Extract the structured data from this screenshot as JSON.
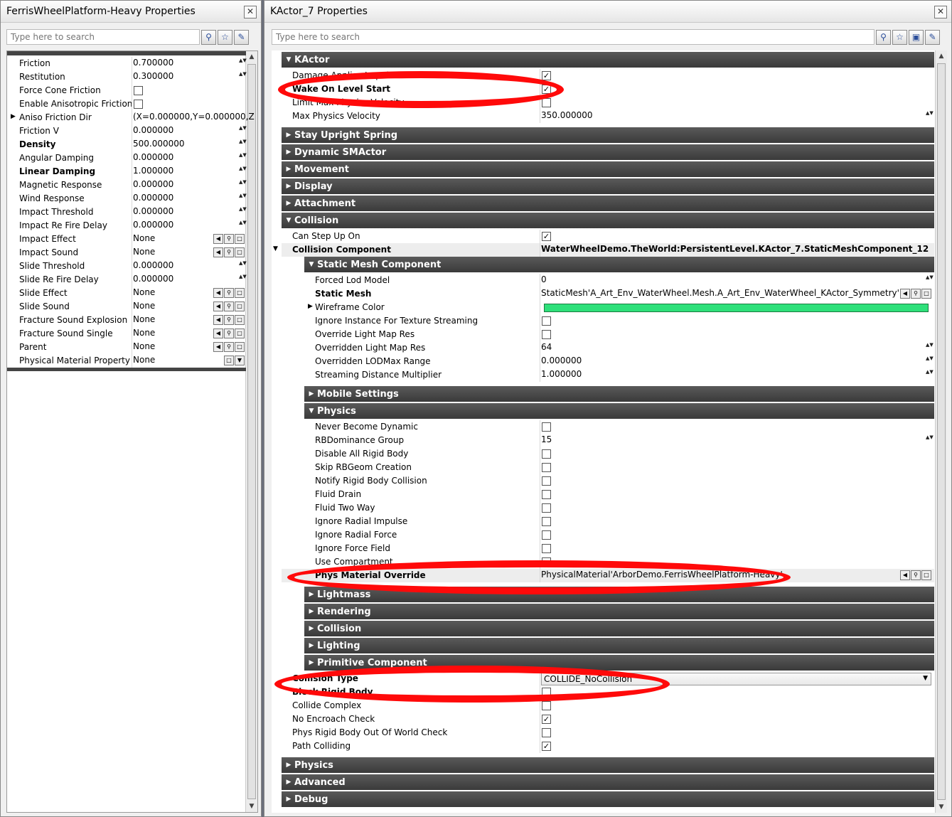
{
  "left_window": {
    "title": "FerrisWheelPlatform-Heavy Properties",
    "search_placeholder": "Type here to search",
    "rows": [
      {
        "name": "Friction",
        "value": "0.700000",
        "bold": false,
        "ctrl": "spin"
      },
      {
        "name": "Restitution",
        "value": "0.300000",
        "bold": false,
        "ctrl": "spin"
      },
      {
        "name": "Force Cone Friction",
        "value": "",
        "bold": false,
        "ctrl": "check",
        "checked": false
      },
      {
        "name": "Enable Anisotropic Friction",
        "value": "",
        "bold": false,
        "ctrl": "check",
        "checked": false
      },
      {
        "name": "Aniso Friction Dir",
        "value": "(X=0.000000,Y=0.000000,Z",
        "bold": false,
        "ctrl": "none",
        "expander": true
      },
      {
        "name": "Friction V",
        "value": "0.000000",
        "bold": false,
        "ctrl": "spin"
      },
      {
        "name": "Density",
        "value": "500.000000",
        "bold": true,
        "ctrl": "spin"
      },
      {
        "name": "Angular Damping",
        "value": "0.000000",
        "bold": false,
        "ctrl": "spin"
      },
      {
        "name": "Linear Damping",
        "value": "1.000000",
        "bold": true,
        "ctrl": "spin"
      },
      {
        "name": "Magnetic Response",
        "value": "0.000000",
        "bold": false,
        "ctrl": "spin"
      },
      {
        "name": "Wind Response",
        "value": "0.000000",
        "bold": false,
        "ctrl": "spin"
      },
      {
        "name": "Impact Threshold",
        "value": "0.000000",
        "bold": false,
        "ctrl": "spin"
      },
      {
        "name": "Impact Re Fire Delay",
        "value": "0.000000",
        "bold": false,
        "ctrl": "spin"
      },
      {
        "name": "Impact Effect",
        "value": "None",
        "bold": false,
        "ctrl": "obj"
      },
      {
        "name": "Impact Sound",
        "value": "None",
        "bold": false,
        "ctrl": "obj"
      },
      {
        "name": "Slide Threshold",
        "value": "0.000000",
        "bold": false,
        "ctrl": "spin"
      },
      {
        "name": "Slide Re Fire Delay",
        "value": "0.000000",
        "bold": false,
        "ctrl": "spin"
      },
      {
        "name": "Slide Effect",
        "value": "None",
        "bold": false,
        "ctrl": "obj"
      },
      {
        "name": "Slide Sound",
        "value": "None",
        "bold": false,
        "ctrl": "obj"
      },
      {
        "name": "Fracture Sound Explosion",
        "value": "None",
        "bold": false,
        "ctrl": "obj"
      },
      {
        "name": "Fracture Sound Single",
        "value": "None",
        "bold": false,
        "ctrl": "obj"
      },
      {
        "name": "Parent",
        "value": "None",
        "bold": false,
        "ctrl": "obj"
      },
      {
        "name": "Physical Material Property",
        "value": "None",
        "bold": false,
        "ctrl": "obj2"
      }
    ]
  },
  "right_window": {
    "title": "KActor_7 Properties",
    "search_placeholder": "Type here to search",
    "items": [
      {
        "kind": "cat",
        "label": "KActor",
        "open": true,
        "indent": 0
      },
      {
        "kind": "row",
        "name": "Damage Applies Impulse",
        "indent": 0,
        "ctrl": "check",
        "checked": true
      },
      {
        "kind": "row",
        "name": "Wake On Level Start",
        "bold": true,
        "indent": 0,
        "ctrl": "check",
        "checked": true
      },
      {
        "kind": "row",
        "name": "Limit Max Physics Velocity",
        "indent": 0,
        "ctrl": "check",
        "checked": false
      },
      {
        "kind": "row",
        "name": "Max Physics Velocity",
        "value": "350.000000",
        "indent": 0,
        "ctrl": "spin"
      },
      {
        "kind": "gap"
      },
      {
        "kind": "cat",
        "label": "Stay Upright Spring",
        "open": false,
        "indent": 0
      },
      {
        "kind": "cat",
        "label": "Dynamic SMActor",
        "open": false,
        "indent": 0
      },
      {
        "kind": "cat",
        "label": "Movement",
        "open": false,
        "indent": 0
      },
      {
        "kind": "cat",
        "label": "Display",
        "open": false,
        "indent": 0
      },
      {
        "kind": "cat",
        "label": "Attachment",
        "open": false,
        "indent": 0
      },
      {
        "kind": "cat",
        "label": "Collision",
        "open": true,
        "indent": 0
      },
      {
        "kind": "row",
        "name": "Can Step Up On",
        "indent": 0,
        "ctrl": "check",
        "checked": true
      },
      {
        "kind": "row",
        "name": "Collision Component",
        "value": "WaterWheelDemo.TheWorld:PersistentLevel.KActor_7.StaticMeshComponent_12",
        "bold": true,
        "valbold": true,
        "indent": 0,
        "expander": "open",
        "shade": true
      },
      {
        "kind": "cat",
        "label": "Static Mesh Component",
        "open": true,
        "indent": 1
      },
      {
        "kind": "row",
        "name": "Forced Lod Model",
        "value": "0",
        "indent": 1,
        "ctrl": "spin"
      },
      {
        "kind": "row",
        "name": "Static Mesh",
        "value": "StaticMesh'A_Art_Env_WaterWheel.Mesh.A_Art_Env_WaterWheel_KActor_Symmetry'",
        "bold": true,
        "indent": 1,
        "ctrl": "obj"
      },
      {
        "kind": "row",
        "name": "Wireframe Color",
        "value": "",
        "indent": 1,
        "ctrl": "color",
        "expander": "closed"
      },
      {
        "kind": "row",
        "name": "Ignore Instance For Texture Streaming",
        "indent": 1,
        "ctrl": "check",
        "checked": false
      },
      {
        "kind": "row",
        "name": "Override Light Map Res",
        "indent": 1,
        "ctrl": "check",
        "checked": false
      },
      {
        "kind": "row",
        "name": "Overridden Light Map Res",
        "value": "64",
        "indent": 1,
        "ctrl": "spin"
      },
      {
        "kind": "row",
        "name": "Overridden LODMax Range",
        "value": "0.000000",
        "indent": 1,
        "ctrl": "spin"
      },
      {
        "kind": "row",
        "name": "Streaming Distance Multiplier",
        "value": "1.000000",
        "indent": 1,
        "ctrl": "spin"
      },
      {
        "kind": "gap"
      },
      {
        "kind": "cat",
        "label": "Mobile Settings",
        "open": false,
        "indent": 1
      },
      {
        "kind": "cat",
        "label": "Physics",
        "open": true,
        "indent": 1
      },
      {
        "kind": "row",
        "name": "Never Become Dynamic",
        "indent": 1,
        "ctrl": "check",
        "checked": false
      },
      {
        "kind": "row",
        "name": "RBDominance Group",
        "value": "15",
        "indent": 1,
        "ctrl": "spin"
      },
      {
        "kind": "row",
        "name": "Disable All Rigid Body",
        "indent": 1,
        "ctrl": "check",
        "checked": false
      },
      {
        "kind": "row",
        "name": "Skip RBGeom Creation",
        "indent": 1,
        "ctrl": "check",
        "checked": false
      },
      {
        "kind": "row",
        "name": "Notify Rigid Body Collision",
        "indent": 1,
        "ctrl": "check",
        "checked": false
      },
      {
        "kind": "row",
        "name": "Fluid Drain",
        "indent": 1,
        "ctrl": "check",
        "checked": false
      },
      {
        "kind": "row",
        "name": "Fluid Two Way",
        "indent": 1,
        "ctrl": "check",
        "checked": false
      },
      {
        "kind": "row",
        "name": "Ignore Radial Impulse",
        "indent": 1,
        "ctrl": "check",
        "checked": false
      },
      {
        "kind": "row",
        "name": "Ignore Radial Force",
        "indent": 1,
        "ctrl": "check",
        "checked": false
      },
      {
        "kind": "row",
        "name": "Ignore Force Field",
        "indent": 1,
        "ctrl": "check",
        "checked": false
      },
      {
        "kind": "row",
        "name": "Use Compartment",
        "indent": 1,
        "ctrl": "check",
        "checked": false
      },
      {
        "kind": "row",
        "name": "Phys Material Override",
        "value": "PhysicalMaterial'ArborDemo.FerrisWheelPlatform-Heavy'",
        "bold": true,
        "indent": 1,
        "ctrl": "obj",
        "shade": true
      },
      {
        "kind": "gap"
      },
      {
        "kind": "cat",
        "label": "Lightmass",
        "open": false,
        "indent": 1
      },
      {
        "kind": "cat",
        "label": "Rendering",
        "open": false,
        "indent": 1
      },
      {
        "kind": "cat",
        "label": "Collision",
        "open": false,
        "indent": 1
      },
      {
        "kind": "cat",
        "label": "Lighting",
        "open": false,
        "indent": 1
      },
      {
        "kind": "cat",
        "label": "Primitive Component",
        "open": false,
        "indent": 1
      },
      {
        "kind": "row",
        "name": "Collision Type",
        "value": "COLLIDE_NoCollision",
        "bold": true,
        "indent": 0,
        "ctrl": "combo"
      },
      {
        "kind": "row",
        "name": "Block Rigid Body",
        "bold": true,
        "indent": 0,
        "ctrl": "check",
        "checked": false
      },
      {
        "kind": "row",
        "name": "Collide Complex",
        "indent": 0,
        "ctrl": "check",
        "checked": false
      },
      {
        "kind": "row",
        "name": "No Encroach Check",
        "indent": 0,
        "ctrl": "check",
        "checked": true
      },
      {
        "kind": "row",
        "name": "Phys Rigid Body Out Of World Check",
        "indent": 0,
        "ctrl": "check",
        "checked": false
      },
      {
        "kind": "row",
        "name": "Path Colliding",
        "indent": 0,
        "ctrl": "check",
        "checked": true
      },
      {
        "kind": "gap"
      },
      {
        "kind": "cat",
        "label": "Physics",
        "open": false,
        "indent": 0
      },
      {
        "kind": "cat",
        "label": "Advanced",
        "open": false,
        "indent": 0
      },
      {
        "kind": "cat",
        "label": "Debug",
        "open": false,
        "indent": 0
      }
    ]
  },
  "colors": {
    "annotation_red": "#ff0a0a",
    "wireframe_color": "#2ee07a",
    "category_bar": "#404040"
  },
  "icons": [
    "close-icon",
    "search-icon",
    "favorites-star-icon",
    "wrench-icon",
    "lock-icon",
    "checkbox-icon",
    "spin-arrows-icon",
    "browse-arrow-icon",
    "find-magnifier-icon",
    "clear-icon",
    "expander-arrow-icon",
    "dropdown-arrow-icon"
  ]
}
